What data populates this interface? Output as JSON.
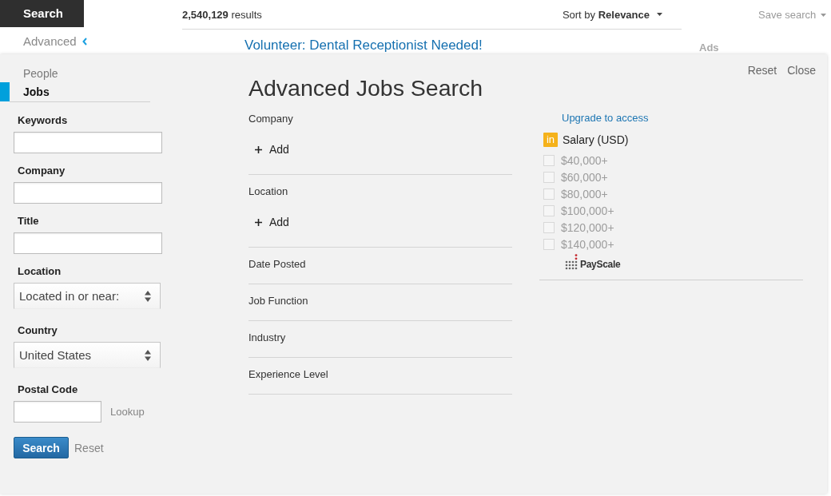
{
  "header": {
    "search_tab": "Search",
    "advanced_link": "Advanced",
    "results": "**2,540,129** results",
    "sort": "Sort by **Relevance**",
    "save_search": "Save search",
    "first_result": "Volunteer: Dental Receptionist Needed!",
    "ads_heading": "Ads"
  },
  "panel": {
    "title": "Advanced Jobs Search",
    "actions": [
      "Reset",
      "Close"
    ],
    "search_types": [
      {
        "label": "People",
        "selected": false
      },
      {
        "label": "Jobs",
        "selected": true
      }
    ],
    "form": {
      "fields": [
        {
          "kind": "text",
          "label": "Keywords"
        },
        {
          "kind": "text",
          "label": "Company"
        },
        {
          "kind": "text",
          "label": "Title"
        },
        {
          "kind": "select",
          "label": "Location",
          "value": "Located in or near:"
        },
        {
          "kind": "select",
          "label": "Country",
          "value": "United States"
        },
        {
          "kind": "postal",
          "label": "Postal Code",
          "link": "Lookup"
        }
      ],
      "buttons": [
        {
          "kind": "primary",
          "label": "Search"
        },
        {
          "kind": "link",
          "label": "Reset"
        }
      ]
    },
    "filters": [
      {
        "kind": "add",
        "label": "Company",
        "action": "Add"
      },
      {
        "kind": "add",
        "label": "Location",
        "action": "Add"
      },
      {
        "kind": "plain",
        "label": "Date Posted"
      },
      {
        "kind": "plain",
        "label": "Job Function"
      },
      {
        "kind": "plain",
        "label": "Industry"
      },
      {
        "kind": "plain",
        "label": "Experience Level"
      }
    ],
    "salary": {
      "upgrade_link": "Upgrade to access",
      "badge": "in",
      "label": "Salary (USD)",
      "options": [
        {
          "label": "$40,000+",
          "checked": false,
          "disabled": true
        },
        {
          "label": "$60,000+",
          "checked": false,
          "disabled": true
        },
        {
          "label": "$80,000+",
          "checked": false,
          "disabled": true
        },
        {
          "label": "$100,000+",
          "checked": false,
          "disabled": true
        },
        {
          "label": "$120,000+",
          "checked": false,
          "disabled": true
        },
        {
          "label": "$140,000+",
          "checked": false,
          "disabled": true
        }
      ],
      "provider": "PayScale"
    }
  }
}
